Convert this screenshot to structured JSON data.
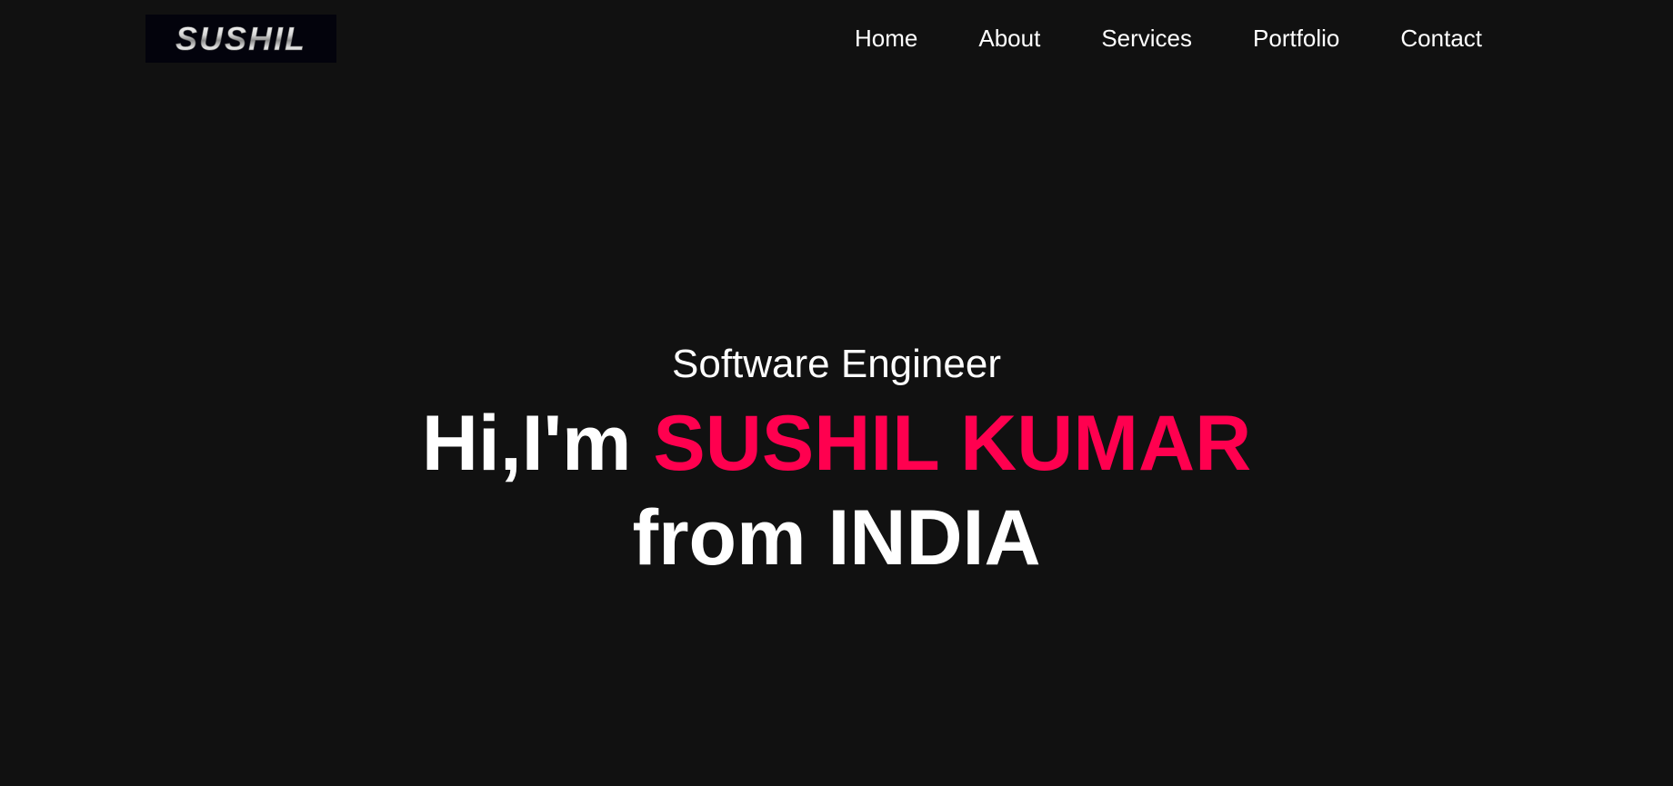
{
  "header": {
    "logo_text": "SUSHIL",
    "nav": [
      {
        "label": "Home"
      },
      {
        "label": "About"
      },
      {
        "label": "Services"
      },
      {
        "label": "Portfolio"
      },
      {
        "label": "Contact"
      }
    ]
  },
  "hero": {
    "subtitle": "Software Engineer",
    "greeting": "Hi,I'm ",
    "name": "SUSHIL KUMAR",
    "location_line": "from INDIA"
  },
  "colors": {
    "background": "#111111",
    "accent": "#ff004f",
    "text": "#ffffff",
    "logo_background": "#03030c"
  }
}
